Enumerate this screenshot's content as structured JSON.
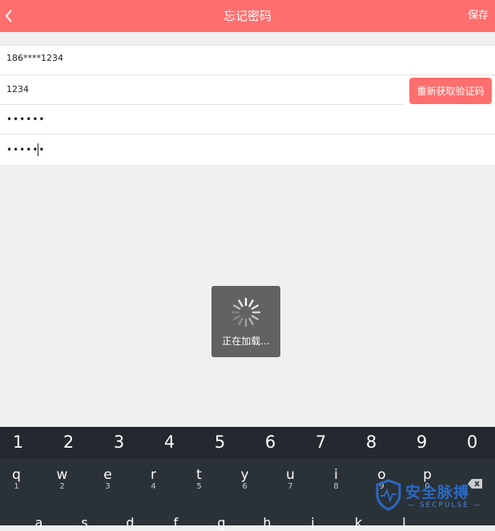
{
  "header": {
    "back_icon": "chevron-left-icon",
    "title": "忘记密码",
    "save_label": "保存"
  },
  "form": {
    "phone_value": "186****1234",
    "code_value": "1234",
    "password_value": "••••••",
    "confirm_value": "••••••",
    "resend_label": "重新获取验证码"
  },
  "loading": {
    "icon": "spinner-icon",
    "text": "正在加载..."
  },
  "keyboard": {
    "numbers": [
      "1",
      "2",
      "3",
      "4",
      "5",
      "6",
      "7",
      "8",
      "9",
      "0"
    ],
    "letters": [
      {
        "key": "q",
        "num": "1"
      },
      {
        "key": "w",
        "num": "2"
      },
      {
        "key": "e",
        "num": "3"
      },
      {
        "key": "r",
        "num": "4"
      },
      {
        "key": "t",
        "num": "5"
      },
      {
        "key": "y",
        "num": "6"
      },
      {
        "key": "u",
        "num": "7"
      },
      {
        "key": "i",
        "num": "8"
      },
      {
        "key": "o",
        "num": "9"
      },
      {
        "key": "p",
        "num": "0"
      }
    ],
    "bottom": [
      "a",
      "s",
      "d",
      "f",
      "g",
      "h",
      "j",
      "k",
      "l"
    ]
  },
  "watermark": {
    "cn": "安全脉搏",
    "en": "— SECPULSE —"
  },
  "colors": {
    "accent": "#fe6f6e",
    "keyboard_bg": "#2a3238"
  }
}
